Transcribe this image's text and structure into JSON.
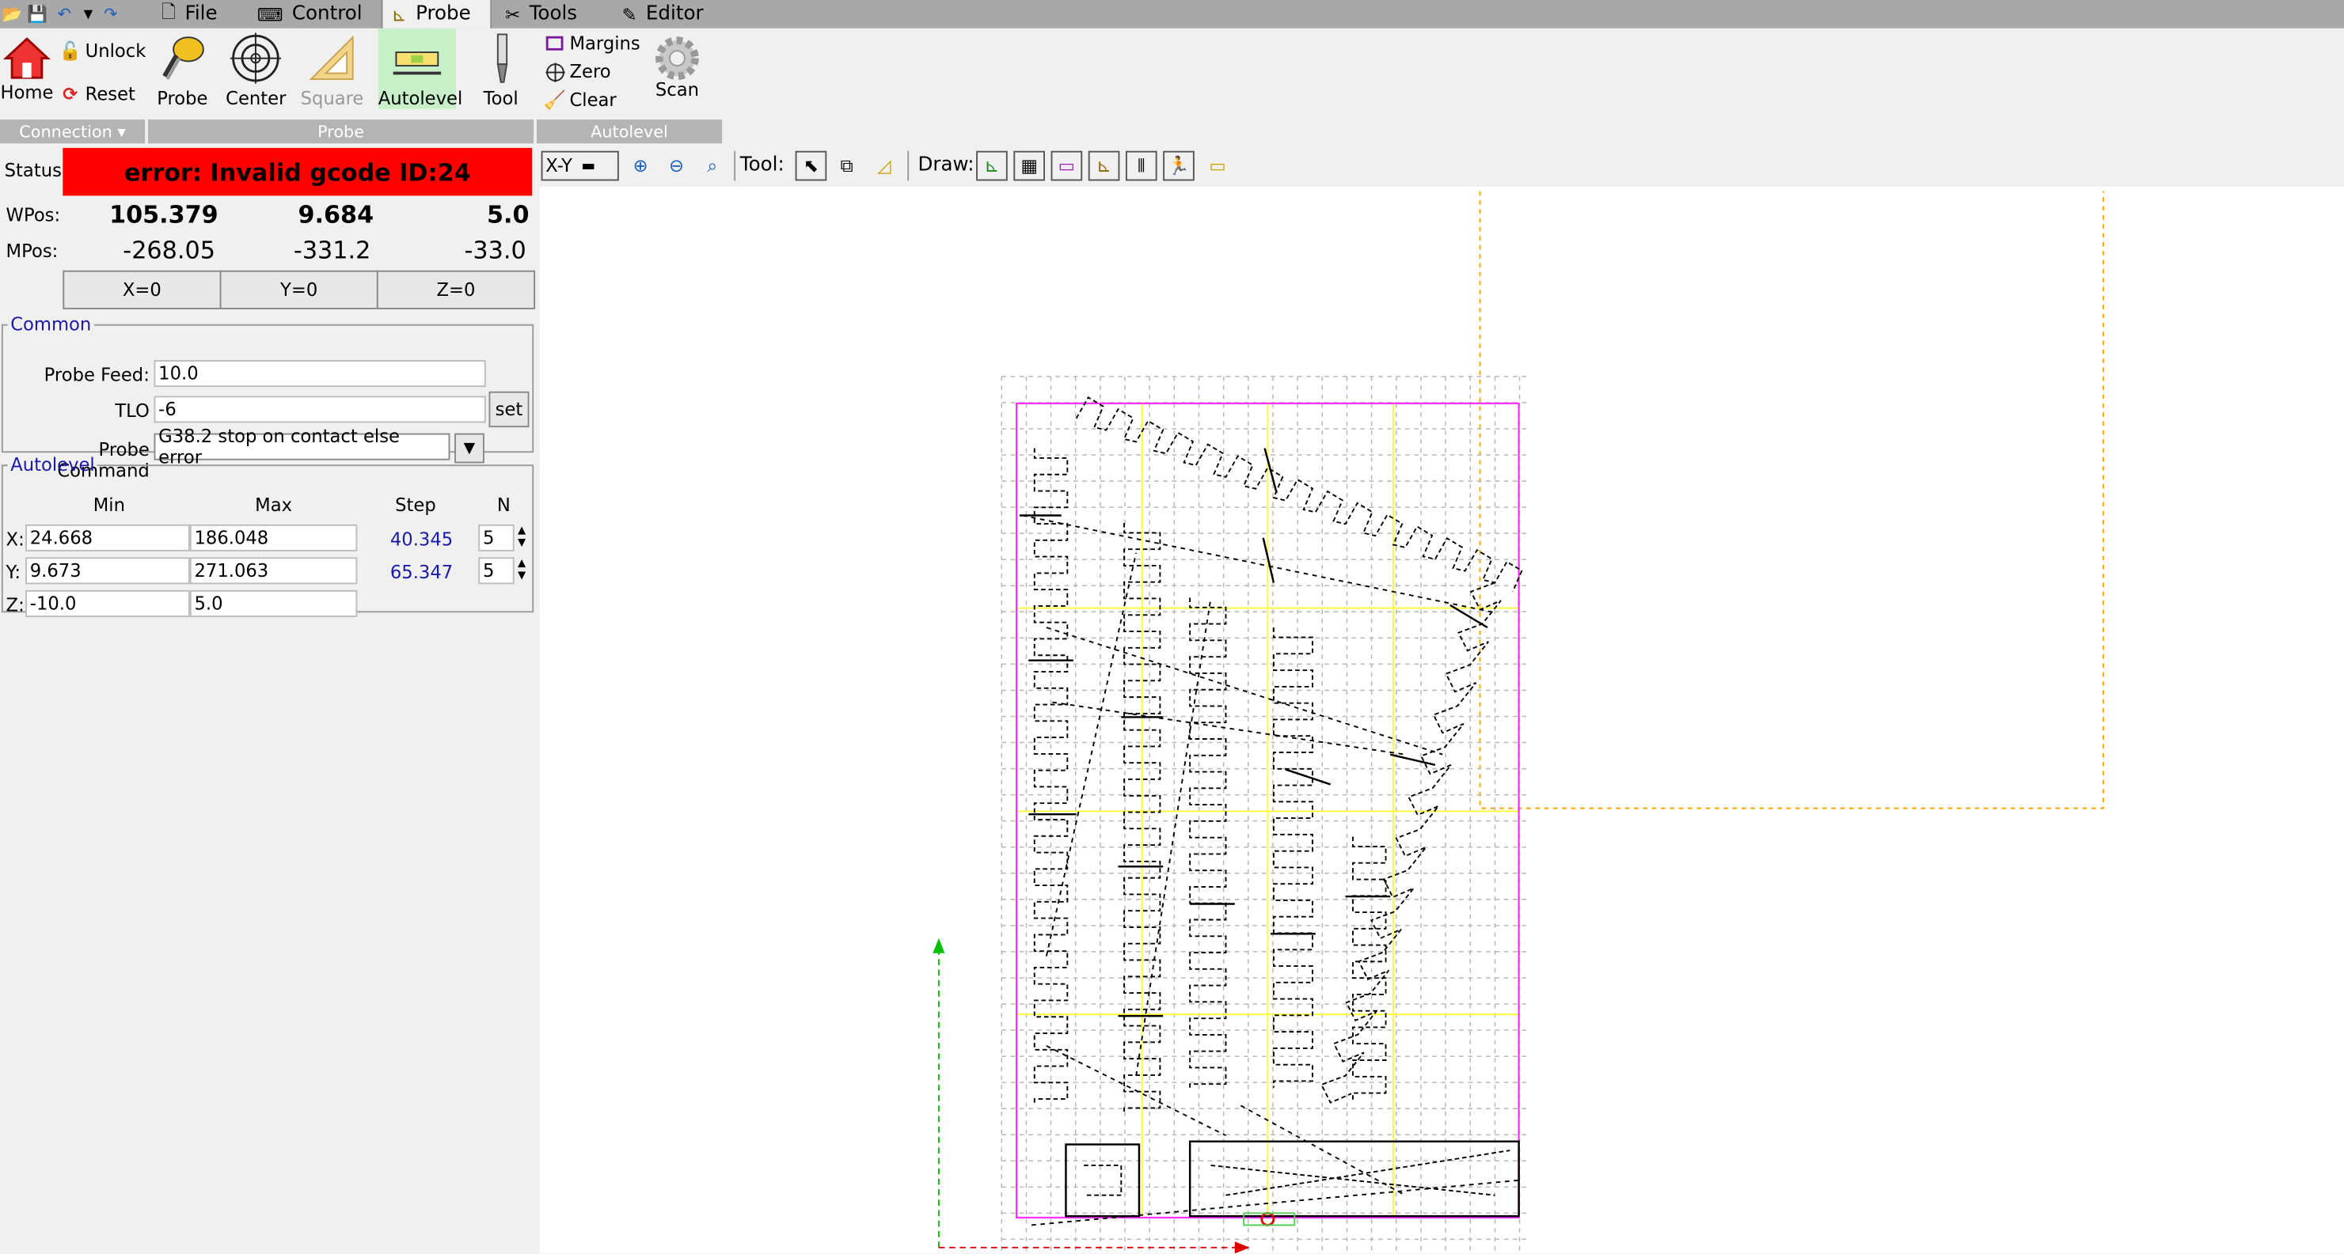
{
  "window": {
    "tabs": [
      {
        "label": "File",
        "icon": "file-icon"
      },
      {
        "label": "Control",
        "icon": "control-icon"
      },
      {
        "label": "Probe",
        "icon": "probe-icon",
        "active": true
      },
      {
        "label": "Tools",
        "icon": "tools-icon"
      },
      {
        "label": "Editor",
        "icon": "editor-icon"
      }
    ]
  },
  "ribbon": {
    "connection": {
      "home": "Home",
      "unlock": "Unlock",
      "reset": "Reset",
      "group": "Connection ▾"
    },
    "probe": {
      "probe": "Probe",
      "center": "Center",
      "square": "Square",
      "autolevel": "Autolevel",
      "tool": "Tool",
      "group": "Probe"
    },
    "autolevel": {
      "margins": "Margins",
      "zero": "Zero",
      "clear": "Clear",
      "scan": "Scan",
      "group": "Autolevel"
    }
  },
  "status": {
    "label": "Status:",
    "text": "error: Invalid gcode ID:24",
    "color": "#ff0000"
  },
  "position": {
    "wpos_label": "WPos:",
    "mpos_label": "MPos:",
    "wpos": {
      "x": "105.379",
      "y": "9.684",
      "z": "5.0"
    },
    "mpos": {
      "x": "-268.05",
      "y": "-331.2",
      "z": "-33.0"
    },
    "zero_buttons": {
      "x": "X=0",
      "y": "Y=0",
      "z": "Z=0"
    }
  },
  "common": {
    "title": "Common",
    "probe_feed_label": "Probe Feed:",
    "probe_feed": "10.0",
    "tlo_label": "TLO",
    "tlo": "-6",
    "set": "set",
    "probe_command_label": "Probe Command",
    "probe_command": "G38.2 stop on contact else error"
  },
  "autolevel_panel": {
    "title": "Autolevel",
    "headers": {
      "min": "Min",
      "max": "Max",
      "step": "Step",
      "n": "N"
    },
    "x": {
      "label": "X:",
      "min": "24.668",
      "max": "186.048",
      "step": "40.345",
      "n": "5"
    },
    "y": {
      "label": "Y:",
      "min": "9.673",
      "max": "271.063",
      "step": "65.347",
      "n": "5"
    },
    "z": {
      "label": "Z:",
      "min": "-10.0",
      "max": "5.0"
    }
  },
  "canvas_toolbar": {
    "view": "X-Y",
    "tool_label": "Tool:",
    "draw_label": "Draw:"
  },
  "colors": {
    "margin": "#ff33ff",
    "grid_major": "#ffff33",
    "limit": "#ffa500",
    "toolpath": "#000000"
  }
}
